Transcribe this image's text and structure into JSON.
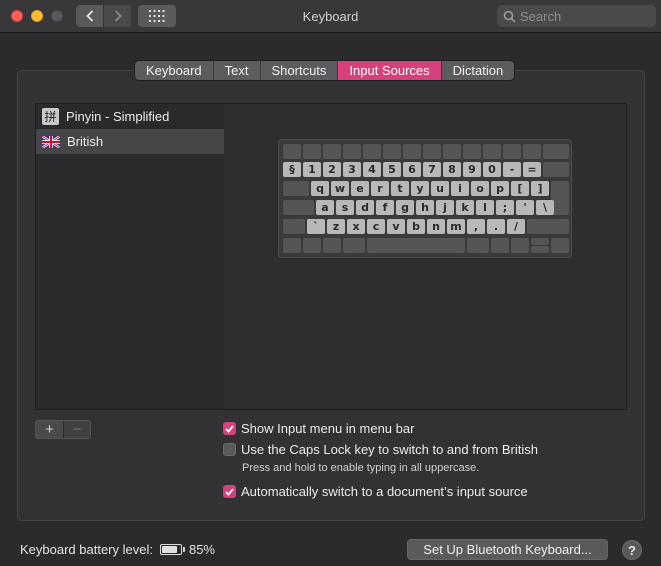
{
  "window": {
    "title": "Keyboard"
  },
  "search": {
    "placeholder": "Search"
  },
  "tabs": [
    {
      "label": "Keyboard"
    },
    {
      "label": "Text"
    },
    {
      "label": "Shortcuts"
    },
    {
      "label": "Input Sources",
      "active": true
    },
    {
      "label": "Dictation"
    }
  ],
  "sources": [
    {
      "label": "Pinyin - Simplified",
      "icon": "pinyin-icon",
      "glyph": "拼"
    },
    {
      "label": "British",
      "icon": "uk-flag-icon",
      "selected": true
    }
  ],
  "keyboard": {
    "row1": [
      "§",
      "1",
      "2",
      "3",
      "4",
      "5",
      "6",
      "7",
      "8",
      "9",
      "0",
      "-",
      "="
    ],
    "row2": [
      "q",
      "w",
      "e",
      "r",
      "t",
      "y",
      "u",
      "i",
      "o",
      "p",
      "[",
      "]"
    ],
    "row3": [
      "a",
      "s",
      "d",
      "f",
      "g",
      "h",
      "j",
      "k",
      "l",
      ";",
      "'",
      "\\"
    ],
    "row4": [
      "`",
      "z",
      "x",
      "c",
      "v",
      "b",
      "n",
      "m",
      ",",
      ".",
      "/"
    ]
  },
  "list_controls": {
    "add": "+",
    "remove": "−"
  },
  "options": {
    "show_menu": {
      "label": "Show Input menu in menu bar",
      "checked": true
    },
    "caps_lock": {
      "label": "Use the Caps Lock key to switch to and from British",
      "checked": false
    },
    "caps_hint": "Press and hold to enable typing in all uppercase.",
    "auto_switch": {
      "label": "Automatically switch to a document’s input source",
      "checked": true
    }
  },
  "footer": {
    "battery_label": "Keyboard battery level:",
    "battery_value": "85%",
    "battery_level": 0.85,
    "bt_button": "Set Up Bluetooth Keyboard...",
    "help": "?"
  },
  "colors": {
    "accent": "#d8407c"
  }
}
